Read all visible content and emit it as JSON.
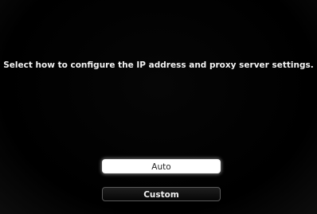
{
  "dialog": {
    "instruction": "Select how to configure the IP address and proxy server settings.",
    "options": [
      {
        "label": "Auto",
        "selected": true
      },
      {
        "label": "Custom",
        "selected": false
      }
    ]
  },
  "colors": {
    "background": "#000000",
    "text": "#f2f2f2",
    "selected_button_bg": "#ffffff",
    "selected_button_text": "#2a2a2a",
    "unselected_button_bg": "#111111",
    "unselected_button_border": "#5a5a5a"
  }
}
